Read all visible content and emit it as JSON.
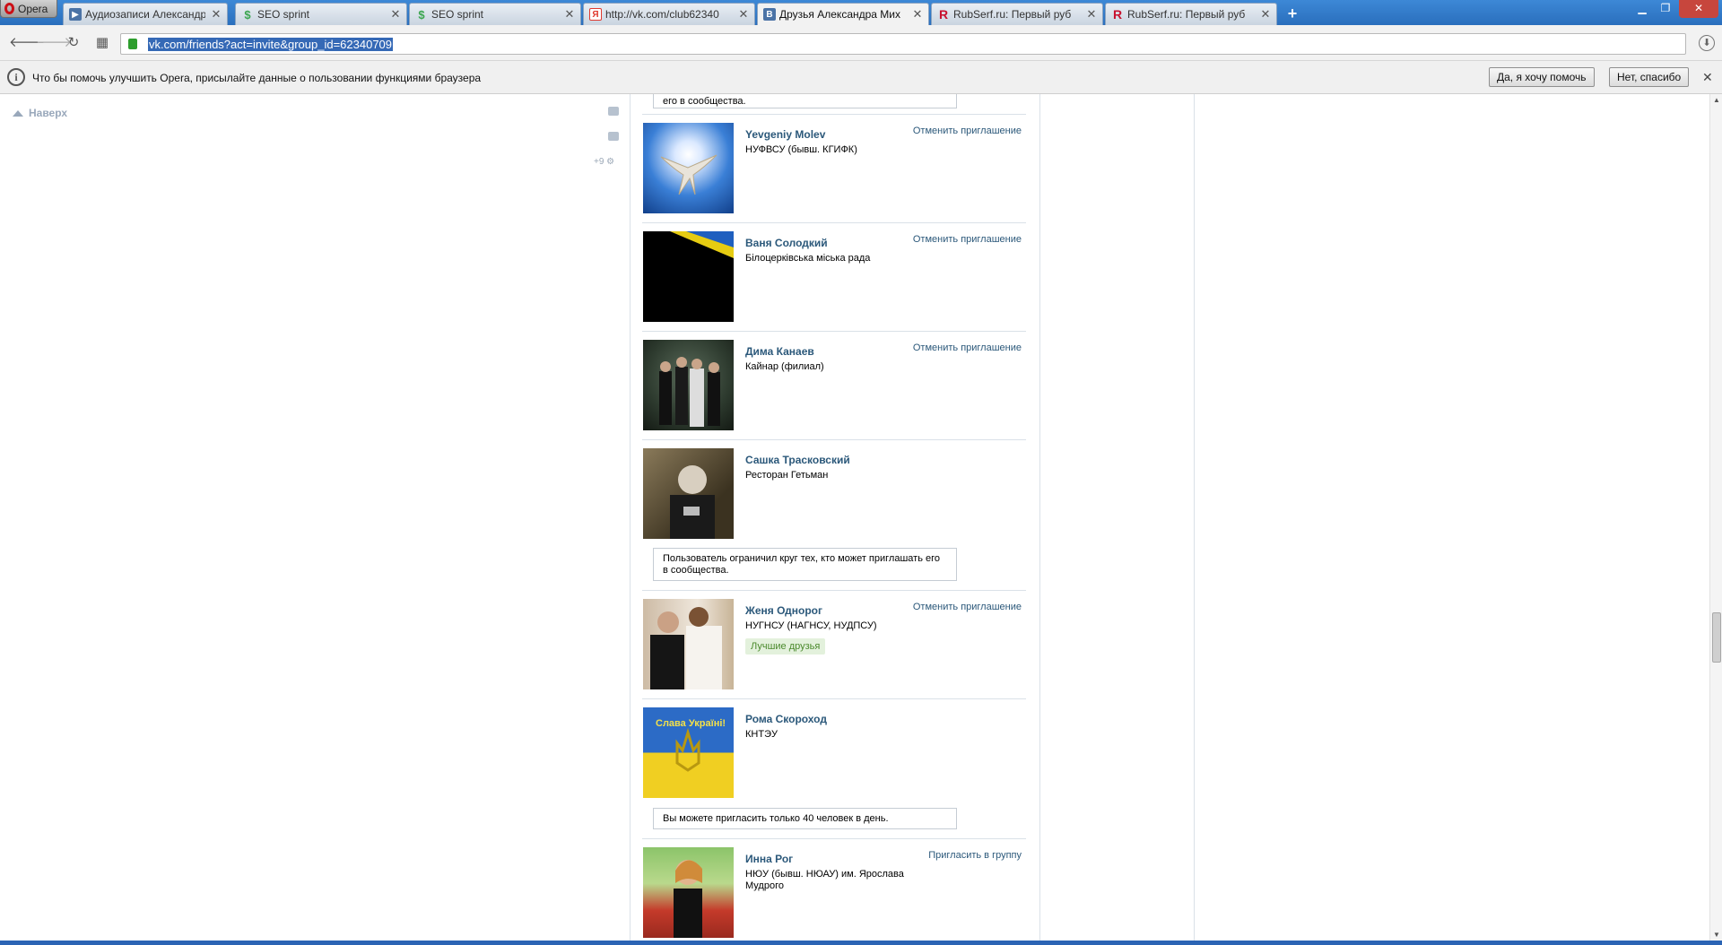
{
  "browser": {
    "menu_label": "Opera",
    "tabs": [
      {
        "label": "Аудиозаписи Александр",
        "icon": "vk-audio-icon",
        "color": "#4b73a6"
      },
      {
        "label": "SEO sprint",
        "icon": "seosprint-icon",
        "color": "#3ba54f"
      },
      {
        "label": "SEO sprint",
        "icon": "seosprint-icon",
        "color": "#3ba54f"
      },
      {
        "label": "http://vk.com/club62340",
        "icon": "yandex-icon",
        "color": "#e03a2e"
      },
      {
        "label": "Друзья Александра Мих",
        "icon": "vk-icon",
        "color": "#4b73a6",
        "active": true
      },
      {
        "label": "RubSerf.ru: Первый руб",
        "icon": "rubserf-icon",
        "color": "#c8102e"
      },
      {
        "label": "RubSerf.ru: Первый руб",
        "icon": "rubserf-icon",
        "color": "#c8102e"
      }
    ],
    "address": "vk.com/friends?act=invite&group_id=62340709",
    "infobar": {
      "text": "Что бы помочь улучшить Opera, присылайте данные о пользовании функциями браузера",
      "yes_label": "Да, я хочу помочь",
      "no_label": "Нет, спасибо"
    }
  },
  "page": {
    "up_link": "Наверх",
    "side_count": "+9",
    "notices": {
      "top_partial": "его в сообщества.",
      "restricted": "Пользователь ограничил круг тех, кто может приглашать его в сообщества.",
      "daily_limit": "Вы можете пригласить только 40 человек в день."
    },
    "friends": [
      {
        "name": "Yevgeniy Molev",
        "sub": "НУФВСУ (бывш. КГИФК)",
        "action": "Отменить приглашение"
      },
      {
        "name": "Ваня Солодкий",
        "sub": "Білоцерківська міська рада",
        "action": "Отменить приглашение"
      },
      {
        "name": "Дима Канаев",
        "sub": "Кайнар (филиал)",
        "action": "Отменить приглашение"
      },
      {
        "name": "Сашка Трасковский",
        "sub": "Ресторан Гетьман",
        "action": ""
      },
      {
        "name": "Женя Однорог",
        "sub": "НУГНСУ (НАГНСУ, НУДПСУ)",
        "action": "Отменить приглашение",
        "badge": "Лучшие друзья"
      },
      {
        "name": "Рома Скороход",
        "sub": "КНТЭУ",
        "action": "",
        "avatar_text": "Слава Україні!"
      },
      {
        "name": "Инна Рог",
        "sub": "НЮУ (бывш. НЮАУ) им. Ярослава Мудрого",
        "action": "Пригласить в группу"
      }
    ]
  }
}
